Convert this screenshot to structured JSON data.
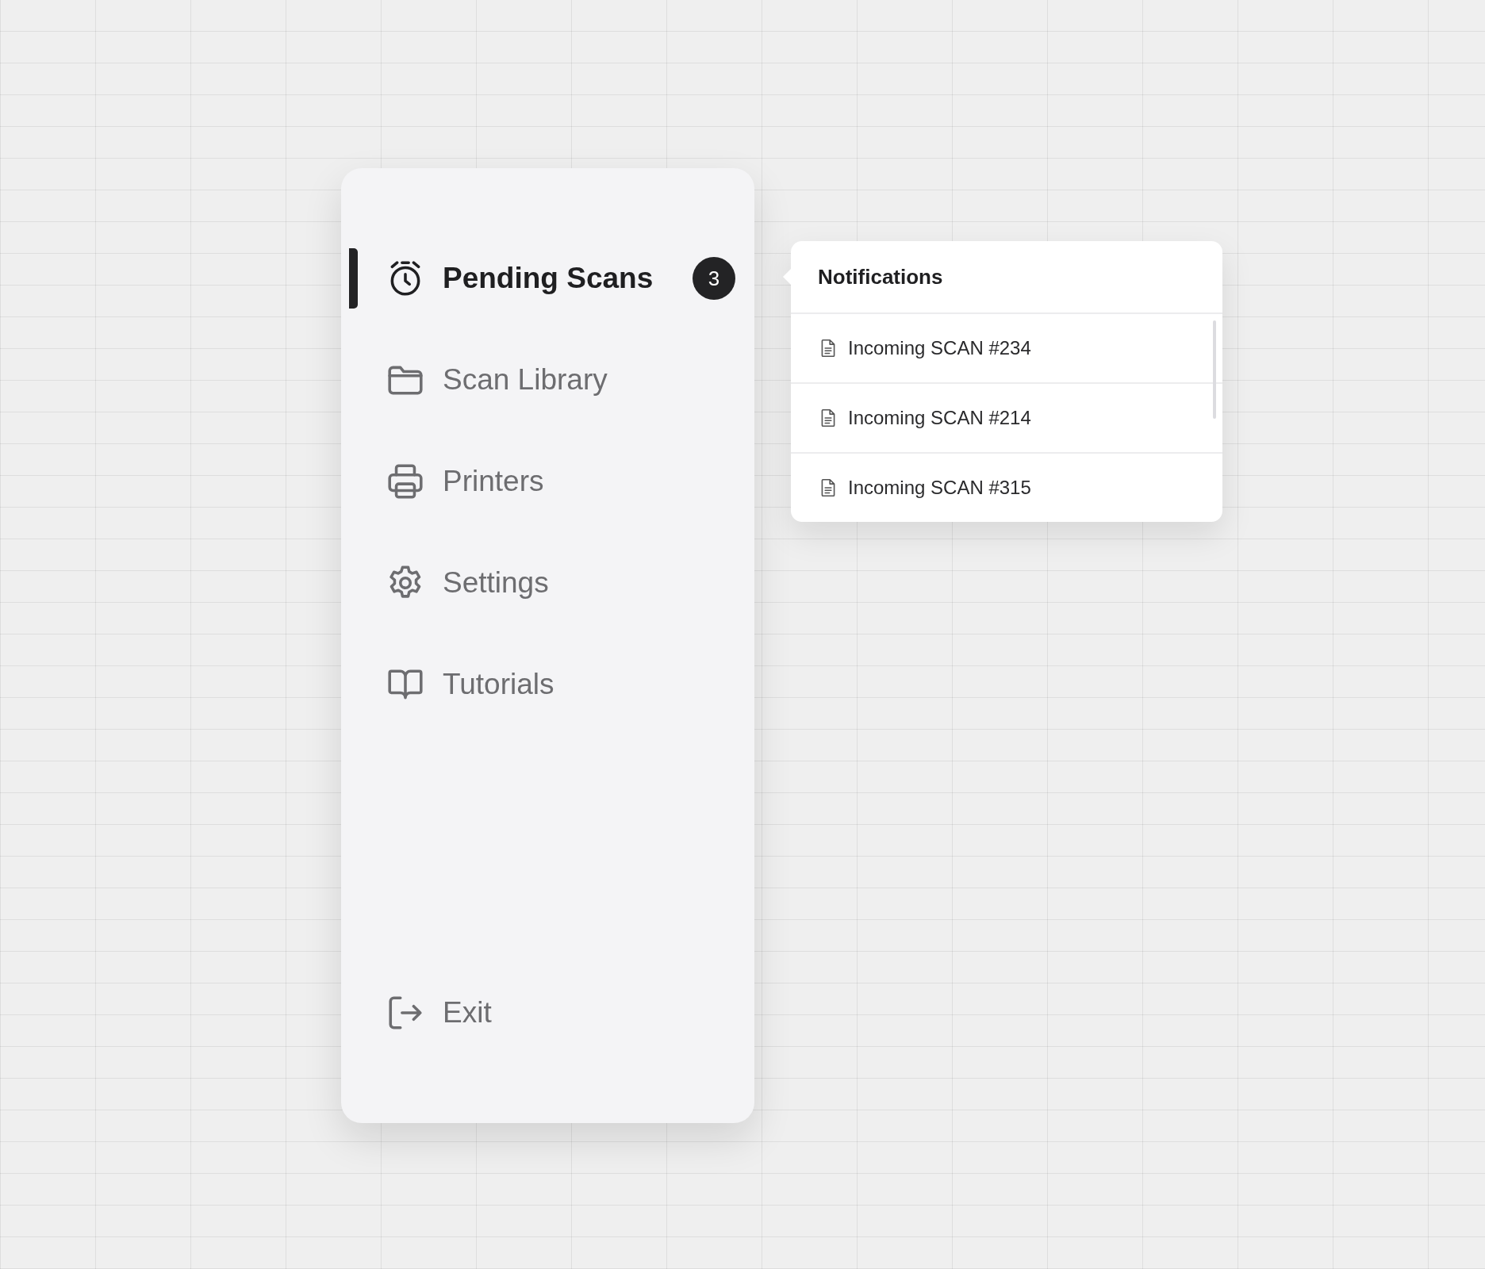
{
  "sidebar": {
    "items": [
      {
        "label": "Pending Scans",
        "selected": true,
        "badge": "3"
      },
      {
        "label": "Scan Library",
        "selected": false
      },
      {
        "label": "Printers",
        "selected": false
      },
      {
        "label": "Settings",
        "selected": false
      },
      {
        "label": "Tutorials",
        "selected": false
      }
    ],
    "footer_item": {
      "label": "Exit"
    }
  },
  "notifications": {
    "title": "Notifications",
    "items": [
      {
        "label": "Incoming SCAN #234"
      },
      {
        "label": "Incoming SCAN #214"
      },
      {
        "label": "Incoming SCAN #315"
      }
    ]
  }
}
